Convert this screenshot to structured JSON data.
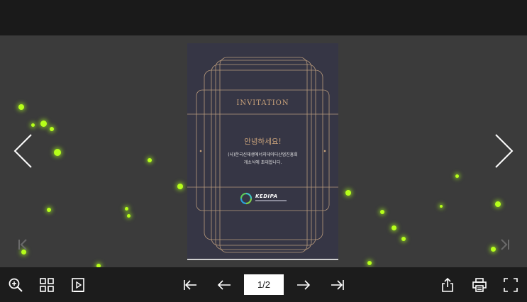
{
  "viewer": {
    "page_indicator": "1/2"
  },
  "invitation": {
    "title": "INVITATION",
    "greeting": "안녕하세요!",
    "body_line1": "(사)한국신재생에너지데이터산업진흥회",
    "body_line2": "개소식에 초대합니다.",
    "logo_text": "KEDIPA"
  },
  "icons": {
    "zoom": "zoom-in-icon",
    "thumbnails": "grid-icon",
    "autoplay": "play-icon",
    "first": "first-page-icon",
    "prev": "previous-page-icon",
    "next": "next-page-icon",
    "last": "last-page-icon",
    "share": "share-icon",
    "print": "print-icon",
    "fullscreen": "fullscreen-icon"
  },
  "colors": {
    "accent_glow": "#b6ff1a",
    "gold": "#c9a27a",
    "page_bg": "#363645",
    "toolbar": "#1c1c1c"
  }
}
